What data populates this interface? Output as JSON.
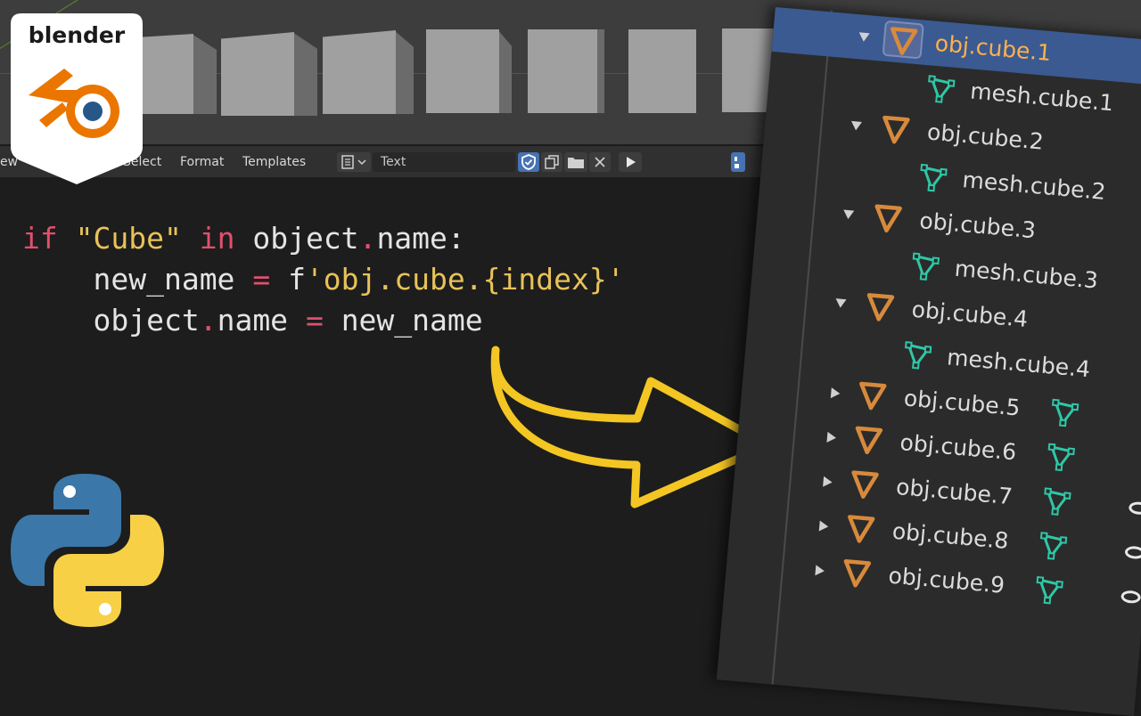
{
  "branding": {
    "blender_wordmark": "blender",
    "logo_icon": "blender-logo-icon",
    "python_icon": "python-logo-icon"
  },
  "header": {
    "menu": [
      "ew",
      "Select",
      "Format",
      "Templates"
    ],
    "text_datablock": "Text"
  },
  "code": {
    "line1": {
      "kw1": "if",
      "str": "\"Cube\"",
      "kw2": "in",
      "obj": "object",
      "dot": ".",
      "attr": "name:"
    },
    "line2": {
      "var": "new_name",
      "eq": "=",
      "prefix": "f",
      "fstr": "'obj.cube.{index}'"
    },
    "line3": {
      "obj": "object",
      "dot": ".",
      "attr": "name",
      "eq": "=",
      "var": "new_name"
    }
  },
  "outliner": {
    "rows": [
      {
        "label": "obj.cube.1",
        "type": "object",
        "expanded": true,
        "selected": true
      },
      {
        "label": "mesh.cube.1",
        "type": "mesh"
      },
      {
        "label": "obj.cube.2",
        "type": "object",
        "expanded": true
      },
      {
        "label": "mesh.cube.2",
        "type": "mesh"
      },
      {
        "label": "obj.cube.3",
        "type": "object",
        "expanded": true
      },
      {
        "label": "mesh.cube.3",
        "type": "mesh"
      },
      {
        "label": "obj.cube.4",
        "type": "object",
        "expanded": true
      },
      {
        "label": "mesh.cube.4",
        "type": "mesh"
      },
      {
        "label": "obj.cube.5",
        "type": "object",
        "expanded": false
      },
      {
        "label": "obj.cube.6",
        "type": "object",
        "expanded": false
      },
      {
        "label": "obj.cube.7",
        "type": "object",
        "expanded": false
      },
      {
        "label": "obj.cube.8",
        "type": "object",
        "expanded": false
      },
      {
        "label": "obj.cube.9",
        "type": "object",
        "expanded": false
      }
    ]
  },
  "colors": {
    "selected_row": "#3b5a91",
    "object_icon": "#d88a3c",
    "mesh_icon": "#2fc7a6",
    "keyword": "#e0506d",
    "string": "#e8c259",
    "arrow_fill": "#f3c623"
  }
}
